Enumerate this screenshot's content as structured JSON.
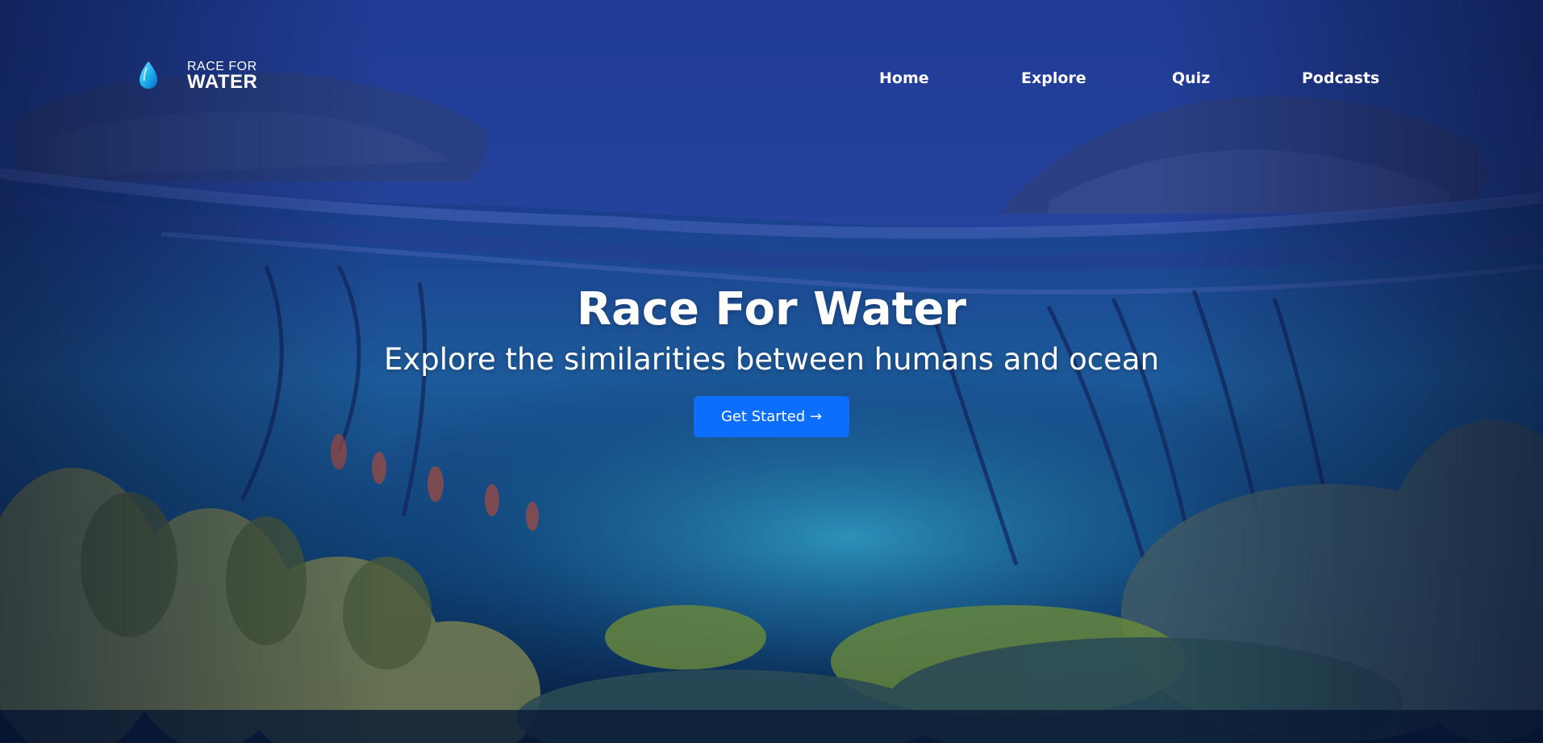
{
  "brand": {
    "line1": "RACE FOR",
    "line2": "WATER"
  },
  "nav": {
    "items": [
      {
        "label": "Home"
      },
      {
        "label": "Explore"
      },
      {
        "label": "Quiz"
      },
      {
        "label": "Podcasts"
      }
    ]
  },
  "hero": {
    "title": "Race For Water",
    "subtitle": "Explore the similarities between humans and ocean",
    "cta_label": "Get Started →"
  },
  "colors": {
    "accent": "#0d6efd",
    "sky": "#1f3a94",
    "deep_water": "#0a2a6b"
  }
}
